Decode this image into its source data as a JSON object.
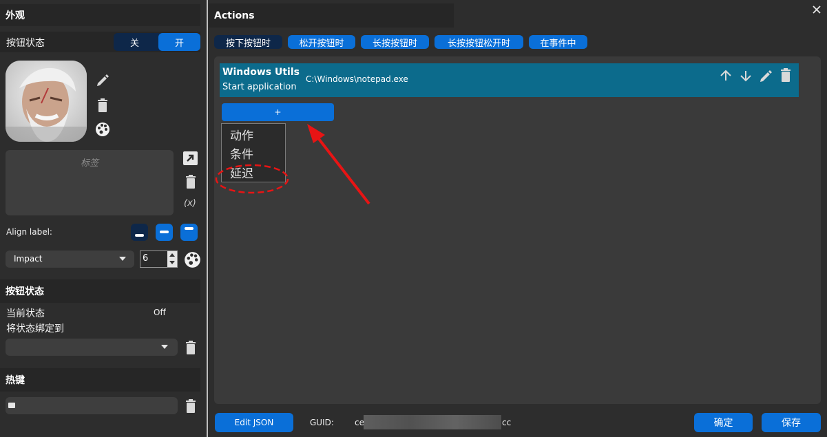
{
  "left": {
    "appearance_title": "外观",
    "button_state_label": "按钮状态",
    "toggle_off": "关",
    "toggle_on": "开",
    "label_placeholder": "标签",
    "formula_text": "(x)",
    "align_label": "Align label:",
    "font_name": "Impact",
    "font_size": "6",
    "button_state_section": "按钮状态",
    "current_state_label": "当前状态",
    "current_state_value": "Off",
    "bind_state_label": "将状态绑定到",
    "bind_state_value": "",
    "hotkey_section": "热键",
    "hotkey_value": ""
  },
  "right": {
    "actions_title": "Actions",
    "tabs": [
      "按下按钮时",
      "松开按钮时",
      "长按按钮时",
      "长按按钮松开时",
      "在事件中"
    ],
    "active_tab_index": 0,
    "action_item": {
      "title": "Windows Utils",
      "subtitle": "Start application",
      "path": "C:\\Windows\\notepad.exe"
    },
    "add_button": "+",
    "add_menu": [
      "动作",
      "条件",
      "延迟"
    ],
    "edit_json": "Edit JSON",
    "guid_label": "GUID:",
    "guid_prefix": "ce",
    "guid_suffix": "cc",
    "ok_button": "确定",
    "save_button": "保存"
  },
  "colors": {
    "accent": "#0a6fd8",
    "active_tab": "#0e2749",
    "action_item_bg": "#0c6b8c",
    "annotation_red": "#e81414"
  },
  "icons": [
    "pencil-icon",
    "trash-icon",
    "palette-icon",
    "open-external-icon",
    "keyboard-icon",
    "chevron-down-icon",
    "arrow-up-icon",
    "arrow-down-icon",
    "close-icon"
  ]
}
